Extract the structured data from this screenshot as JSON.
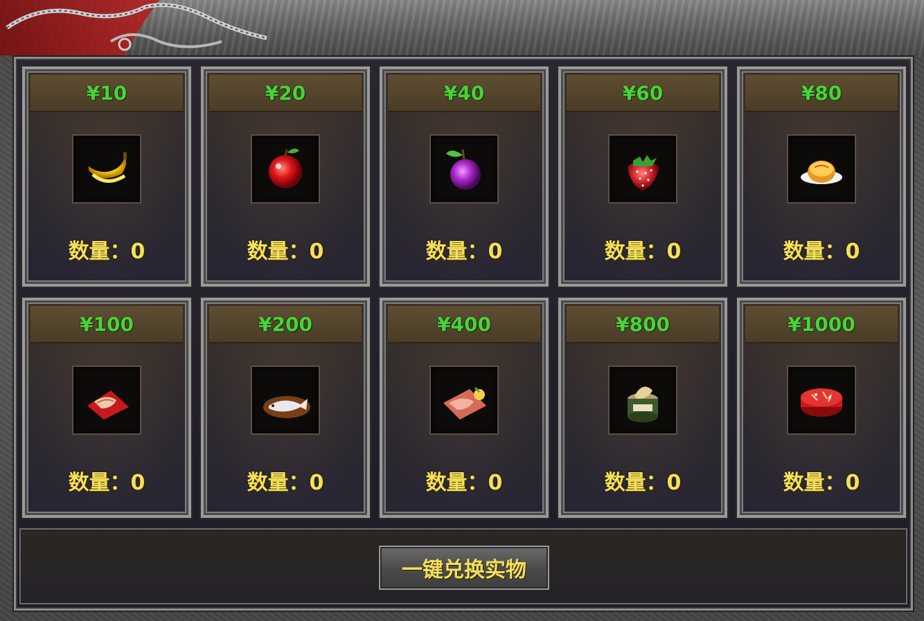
{
  "items": [
    {
      "price": "¥10",
      "icon": "banana-icon",
      "qty": "数量：0"
    },
    {
      "price": "¥20",
      "icon": "apple-icon",
      "qty": "数量：0"
    },
    {
      "price": "¥40",
      "icon": "plum-icon",
      "qty": "数量：0"
    },
    {
      "price": "¥60",
      "icon": "strawberry-icon",
      "qty": "数量：0"
    },
    {
      "price": "¥80",
      "icon": "mooncake-icon",
      "qty": "数量：0"
    },
    {
      "price": "¥100",
      "icon": "meat-slice-icon",
      "qty": "数量：0"
    },
    {
      "price": "¥200",
      "icon": "fish-icon",
      "qty": "数量：0"
    },
    {
      "price": "¥400",
      "icon": "steak-icon",
      "qty": "数量：0"
    },
    {
      "price": "¥800",
      "icon": "canned-pork-icon",
      "qty": "数量：0"
    },
    {
      "price": "¥1000",
      "icon": "cake-icon",
      "qty": "数量：0"
    }
  ],
  "actions": {
    "exchange_label": "一键兑换实物"
  },
  "colors": {
    "price": "#4cd13a",
    "quantity": "#f4e05a",
    "button_text": "#f4e05a"
  }
}
